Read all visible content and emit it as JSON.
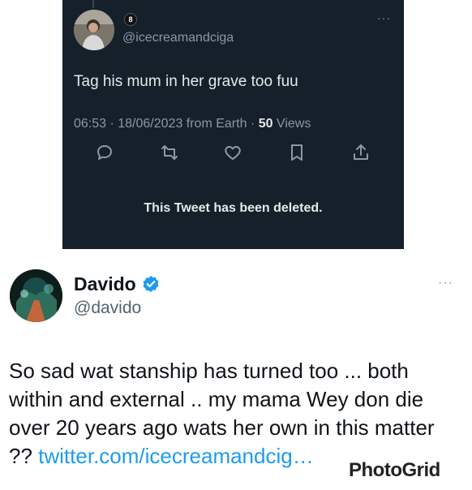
{
  "embedded_tweet": {
    "badge": "8",
    "handle": "@icecreamandciga",
    "more": "···",
    "text": "Tag his mum in her grave too fuu",
    "meta_time": "06:53 · 18/06/2023 from Earth · ",
    "meta_views_count": "50",
    "meta_views_label": " Views",
    "actions": [
      "reply-icon",
      "retweet-icon",
      "like-icon",
      "bookmark-icon",
      "share-icon"
    ],
    "deleted_notice": "This Tweet has been deleted."
  },
  "tweet": {
    "name": "Davido",
    "handle": "@davido",
    "more": "···",
    "body": "So sad wat stanship has turned too ... both within and external .. my mama Wey don die over 20 years ago wats her own in this matter ?? ",
    "link": "twitter.com/icecreamandcig…"
  },
  "watermark": "PhotoGrid",
  "colors": {
    "dark_bg": "#15202b",
    "link": "#1d9bf0",
    "verified": "#1d9bf0"
  }
}
